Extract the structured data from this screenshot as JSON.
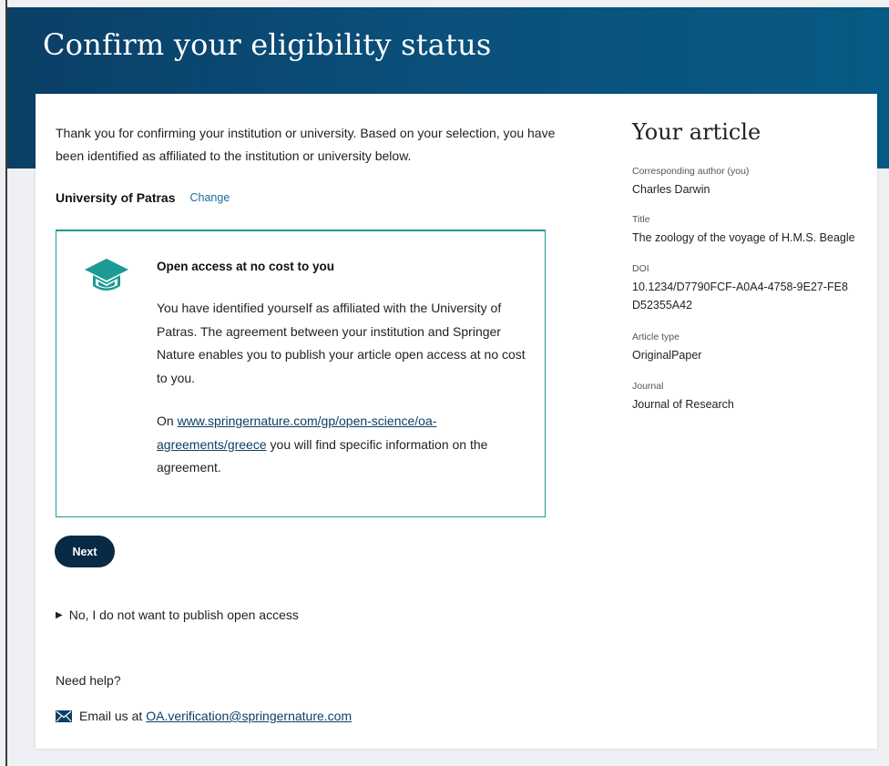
{
  "page": {
    "title": "Confirm your eligibility status"
  },
  "intro": {
    "text": "Thank you for confirming your institution or university. Based on your selection, you have been identified as affiliated to the institution or university below."
  },
  "institution": {
    "name": "University of Patras",
    "change_label": "Change"
  },
  "oa_box": {
    "icon": "graduation-cap-icon",
    "title": "Open access at no cost to you",
    "description": "You have identified yourself as affiliated with the University of Patras. The agreement between your institution and Springer Nature enables you to publish your article open access at no cost to you.",
    "link_prefix": "On ",
    "link_text": "www.springernature.com/gp/open-science/oa-agreements/greece",
    "link_suffix": " you will find specific information on the agreement."
  },
  "actions": {
    "next_label": "Next",
    "decline_label": "No, I do not want to publish open access"
  },
  "help": {
    "title": "Need help?",
    "email_prefix": "Email us at",
    "email": "OA.verification@springernature.com"
  },
  "article": {
    "heading": "Your article",
    "author_label": "Corresponding author (you)",
    "author_value": "Charles Darwin",
    "title_label": "Title",
    "title_value": "The zoology of the voyage of H.M.S. Beagle",
    "doi_label": "DOI",
    "doi_value": "10.1234/D7790FCF-A0A4-4758-9E27-FE8D52355A42",
    "type_label": "Article type",
    "type_value": "OriginalPaper",
    "journal_label": "Journal",
    "journal_value": "Journal of Research"
  },
  "colors": {
    "hero": "#0b3f66",
    "accent_teal": "#1d9a95",
    "button": "#082a45",
    "link": "#1b6a9c"
  }
}
